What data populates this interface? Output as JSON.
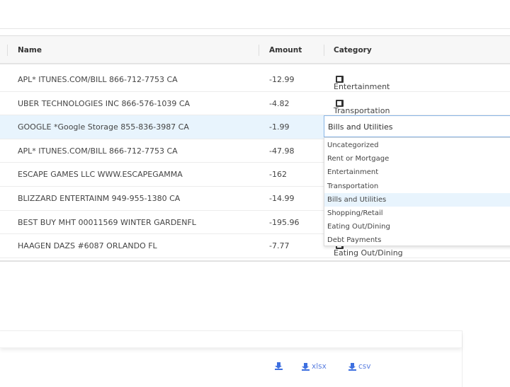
{
  "table": {
    "headers": {
      "name": "Name",
      "amount": "Amount",
      "category": "Category"
    },
    "rows": [
      {
        "name": "APL* ITUNES.COM/BILL 866-712-7753 CA",
        "amount": "-12.99",
        "category": "Entertainment"
      },
      {
        "name": "UBER TECHNOLOGIES INC 866-576-1039 CA",
        "amount": "-4.82",
        "category": "Transportation"
      },
      {
        "name": "GOOGLE *Google Storage 855-836-3987 CA",
        "amount": "-1.99",
        "category": "Bills and Utilities"
      },
      {
        "name": "APL* ITUNES.COM/BILL 866-712-7753 CA",
        "amount": "-47.98",
        "category": ""
      },
      {
        "name": "ESCAPE GAMES LLC WWW.ESCAPEGAMMA",
        "amount": "-162",
        "category": ""
      },
      {
        "name": "BLIZZARD ENTERTAINM 949-955-1380 CA",
        "amount": "-14.99",
        "category": ""
      },
      {
        "name": "BEST BUY MHT 00011569 WINTER GARDENFL",
        "amount": "-195.96",
        "category": ""
      },
      {
        "name": "HAAGEN DAZS #6087 ORLANDO FL",
        "amount": "-7.77",
        "category": "Eating Out/Dining"
      }
    ]
  },
  "category_dropdown": {
    "value": "Bills and Utilities",
    "options": [
      "Uncategorized",
      "Rent or Mortgage",
      "Entertainment",
      "Transportation",
      "Bills and Utilities",
      "Shopping/Retail",
      "Eating Out/Dining",
      "Debt Payments"
    ],
    "highlighted": "Bills and Utilities"
  },
  "downloads": {
    "xlsx": "xlsx",
    "csv": "csv"
  },
  "colors": {
    "accent": "#3d6fe0",
    "selected_row": "#e8f4fd"
  }
}
